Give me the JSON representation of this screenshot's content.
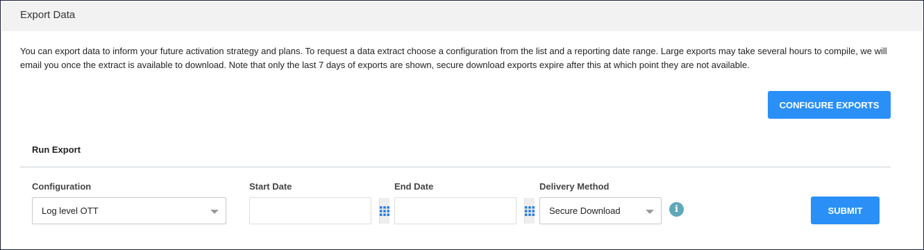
{
  "header": {
    "title": "Export Data"
  },
  "description": "You can export data to inform your future activation strategy and plans. To request a data extract choose a configuration from the list and a reporting date range. Large exports may take several hours to compile, we will email you once the extract is available to download. Note that only the last 7 days of exports are shown, secure download exports expire after this at which point they are not available.",
  "buttons": {
    "configure_exports": "CONFIGURE EXPORTS",
    "submit": "SUBMIT"
  },
  "run_export": {
    "title": "Run Export",
    "configuration": {
      "label": "Configuration",
      "selected": "Log level OTT"
    },
    "start_date": {
      "label": "Start Date",
      "value": ""
    },
    "end_date": {
      "label": "End Date",
      "value": ""
    },
    "delivery_method": {
      "label": "Delivery Method",
      "selected": "Secure Download"
    },
    "info_icon_glyph": "i"
  },
  "colors": {
    "primary_button": "#2a90f7",
    "info_icon": "#5fa8b9",
    "header_bg": "#f2f2f2"
  },
  "icons": {
    "calendar": "calendar-grid-icon",
    "dropdown": "chevron-down-icon",
    "info": "info-icon"
  }
}
